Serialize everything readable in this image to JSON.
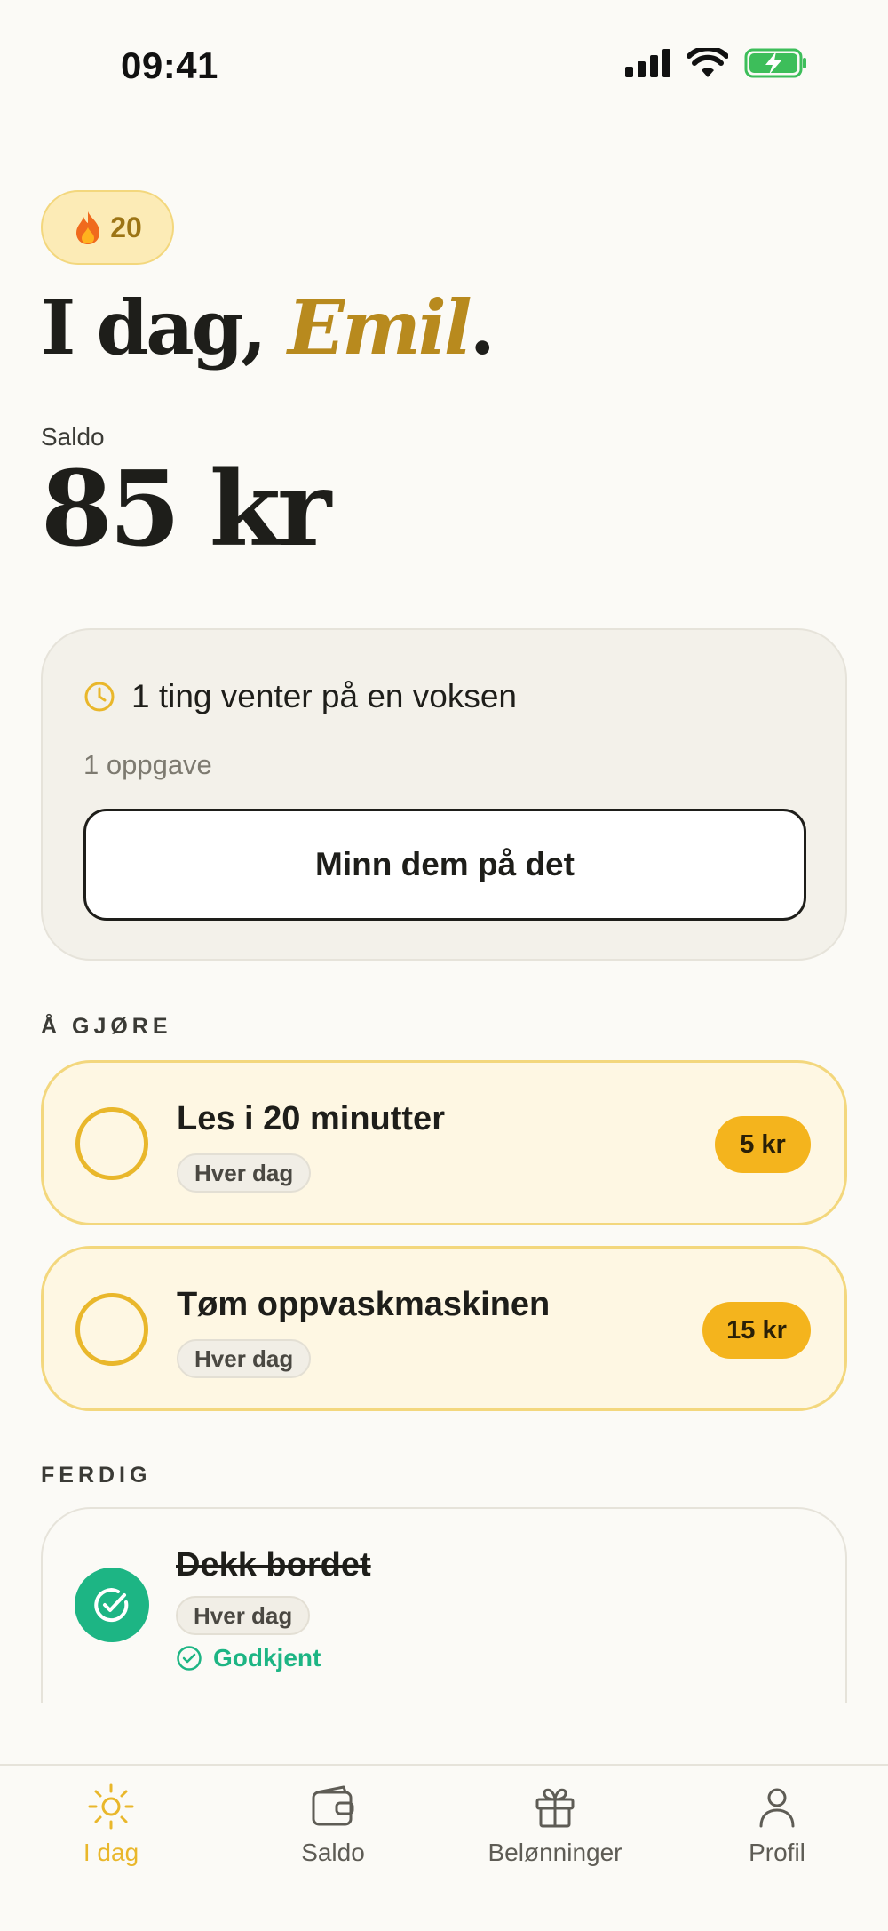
{
  "status_bar": {
    "time": "09:41"
  },
  "header": {
    "streak_count": "20",
    "greeting_prefix": "I dag,",
    "greeting_name": "Emil",
    "greeting_suffix": ".",
    "balance_label": "Saldo",
    "balance_value": "85 kr"
  },
  "pending": {
    "title": "1 ting venter på en voksen",
    "subtitle": "1 oppgave",
    "button_label": "Minn dem på det"
  },
  "todo": {
    "section_label": "Å GJØRE",
    "tasks": [
      {
        "title": "Les i 20 minutter",
        "frequency": "Hver dag",
        "reward": "5 kr"
      },
      {
        "title": "Tøm oppvaskmaskinen",
        "frequency": "Hver dag",
        "reward": "15 kr"
      }
    ]
  },
  "done": {
    "section_label": "FERDIG",
    "tasks": [
      {
        "title": "Dekk bordet",
        "frequency": "Hver dag",
        "status": "Godkjent"
      }
    ]
  },
  "nav": {
    "items": [
      {
        "label": "I dag",
        "icon": "sun-icon",
        "active": true
      },
      {
        "label": "Saldo",
        "icon": "wallet-icon",
        "active": false
      },
      {
        "label": "Belønninger",
        "icon": "gift-icon",
        "active": false
      },
      {
        "label": "Profil",
        "icon": "person-icon",
        "active": false
      }
    ]
  },
  "colors": {
    "accent": "#E9B72B",
    "accent_dark": "#B88A1E",
    "reward_pill": "#F4B41D",
    "success": "#1DB584",
    "background": "#FBFAF6"
  }
}
